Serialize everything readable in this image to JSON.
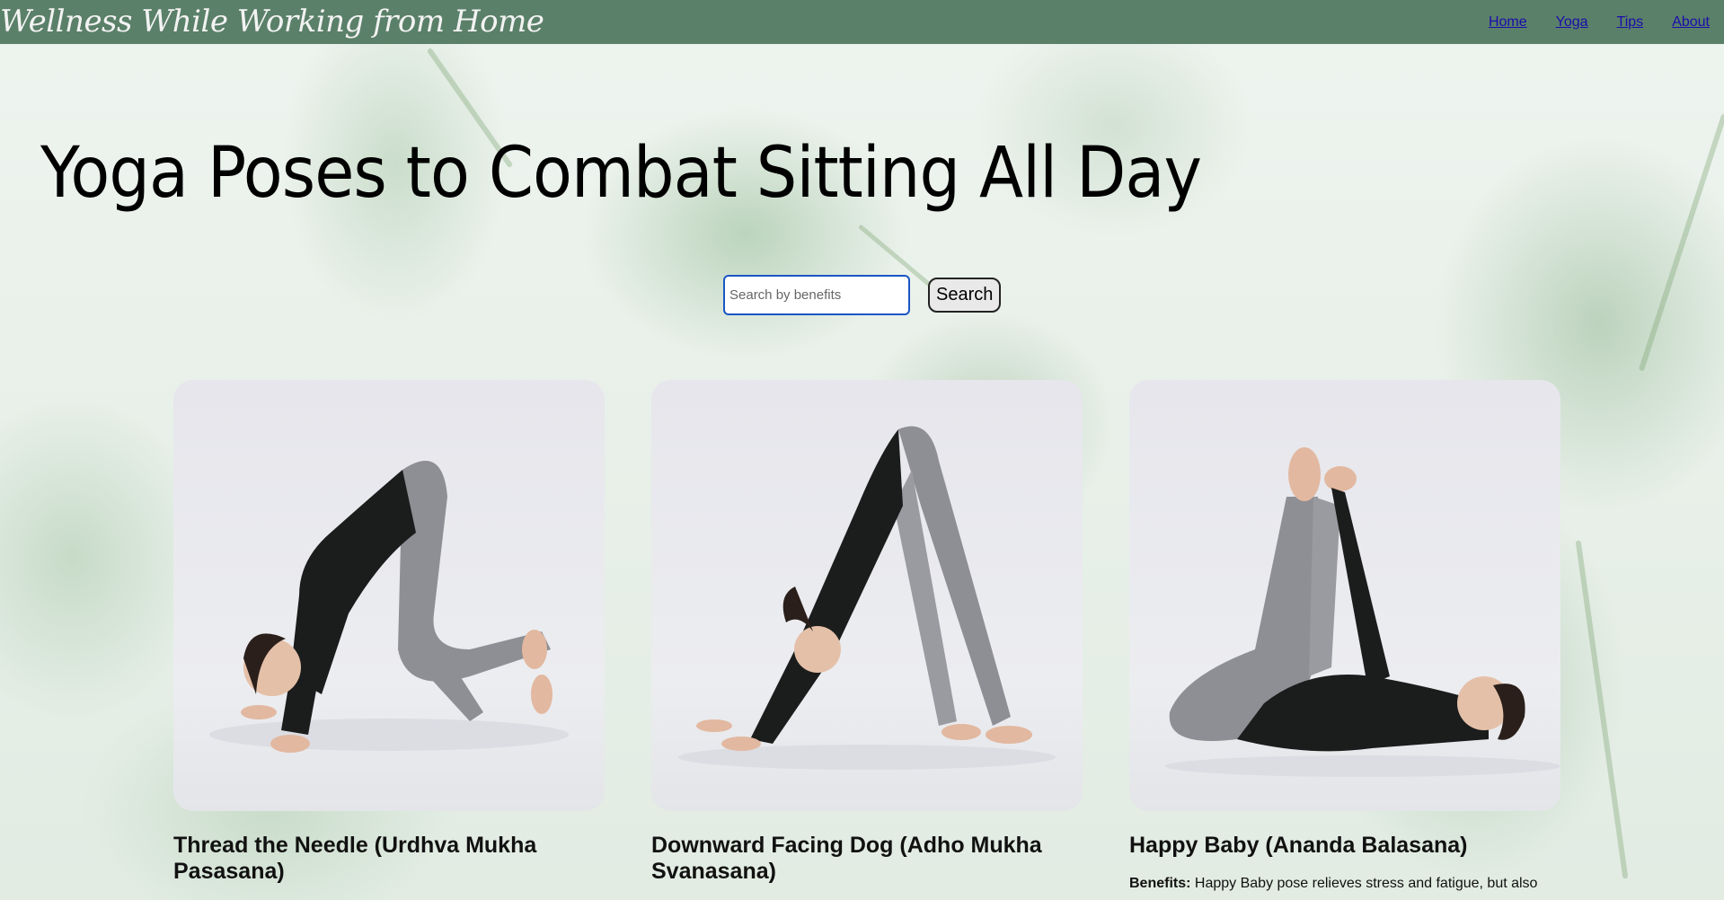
{
  "header": {
    "site_title": "Wellness While Working from Home",
    "nav": [
      "Home",
      "Yoga",
      "Tips",
      "About"
    ]
  },
  "main": {
    "page_title": "Yoga Poses to Combat Sitting All Day",
    "search": {
      "placeholder": "Search by benefits",
      "value": "",
      "button_label": "Search"
    },
    "cards": [
      {
        "title": "Thread the Needle (Urdhva Mukha Pasasana)",
        "image_icon": "thread-the-needle-pose-photo",
        "benefits_label": "",
        "benefits_text": ""
      },
      {
        "title": "Downward Facing Dog (Adho Mukha Svanasana)",
        "image_icon": "downward-dog-pose-photo",
        "benefits_label": "",
        "benefits_text": ""
      },
      {
        "title": "Happy Baby (Ananda Balasana)",
        "image_icon": "happy-baby-pose-photo",
        "benefits_label": "Benefits:",
        "benefits_text": " Happy Baby pose relieves stress and fatigue, but also"
      }
    ]
  },
  "colors": {
    "header_bg": "#5b8069",
    "link": "#1a0dab",
    "search_border": "#1a56c4",
    "background": "#e6efe8"
  }
}
